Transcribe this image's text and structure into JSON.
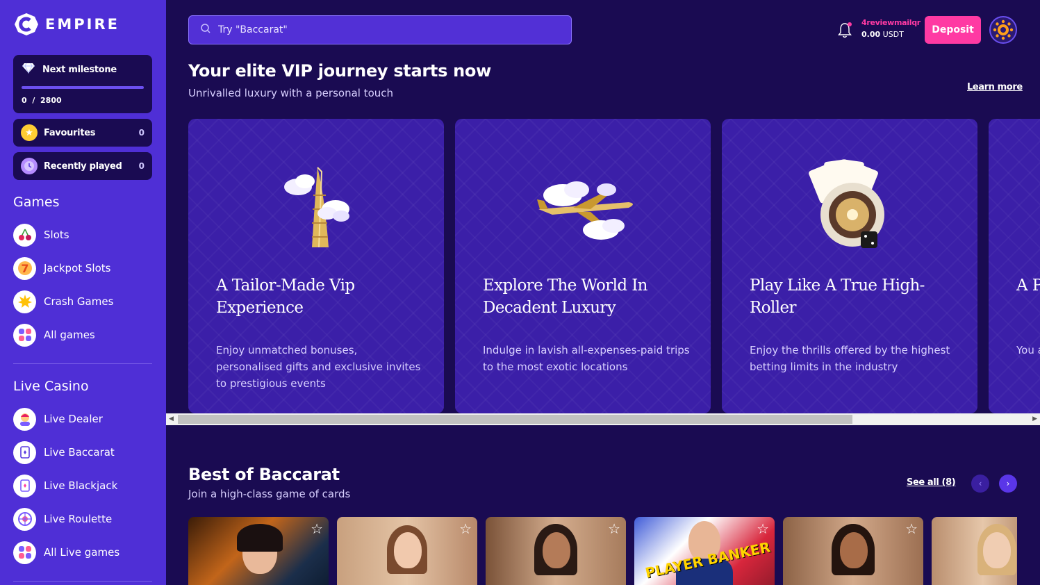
{
  "brand": {
    "name": "EMPIRE"
  },
  "search": {
    "placeholder": "Try \"Baccarat\""
  },
  "user": {
    "username": "4reviewmailqr",
    "balance_amount": "0.00",
    "balance_currency": "USDT"
  },
  "header": {
    "deposit_label": "Deposit"
  },
  "milestone": {
    "title": "Next milestone",
    "current": "0",
    "separator": "/",
    "target": "2800",
    "progress": 0
  },
  "quick": {
    "favourites": {
      "label": "Favourites",
      "count": "0"
    },
    "recent": {
      "label": "Recently played",
      "count": "0"
    }
  },
  "sidebar": {
    "games_title": "Games",
    "games": [
      {
        "label": "Slots",
        "icon": "cherry-icon"
      },
      {
        "label": "Jackpot Slots",
        "icon": "seven-icon"
      },
      {
        "label": "Crash Games",
        "icon": "explosion-icon"
      },
      {
        "label": "All games",
        "icon": "grid-icon"
      }
    ],
    "live_title": "Live Casino",
    "live": [
      {
        "label": "Live Dealer",
        "icon": "dealer-icon"
      },
      {
        "label": "Live Baccarat",
        "icon": "cards-icon"
      },
      {
        "label": "Live Blackjack",
        "icon": "card-icon"
      },
      {
        "label": "Live Roulette",
        "icon": "roulette-icon"
      },
      {
        "label": "All Live games",
        "icon": "grid-icon"
      }
    ]
  },
  "vip": {
    "title": "Your elite VIP journey starts now",
    "subtitle": "Unrivalled luxury with a personal touch",
    "learn_more": "Learn more",
    "cards": [
      {
        "title": "A Tailor-Made Vip Experience",
        "desc": "Enjoy unmatched bonuses, personalised gifts and exclusive invites to prestigious events",
        "art": "tower-icon"
      },
      {
        "title": "Explore The World In Decadent Luxury",
        "desc": "Indulge in lavish all-expenses-paid trips to the most exotic locations",
        "art": "plane-icon"
      },
      {
        "title": "Play Like A True High-Roller",
        "desc": "Enjoy the thrills offered by the highest betting limits in the industry",
        "art": "roulette-cards-icon"
      },
      {
        "title": "A P",
        "desc": "You a pers",
        "art": ""
      }
    ]
  },
  "baccarat": {
    "title": "Best of Baccarat",
    "subtitle": "Join a high-class game of cards",
    "see_all": "See all (8)",
    "games": [
      {
        "theme": "dragon",
        "overlay": ""
      },
      {
        "theme": "dealer-pink",
        "overlay": ""
      },
      {
        "theme": "dealer-smile",
        "overlay": ""
      },
      {
        "theme": "player-banker",
        "overlay": "PLAYER BANKER"
      },
      {
        "theme": "dealer-dark",
        "overlay": ""
      },
      {
        "theme": "dealer-blonde",
        "overlay": ""
      }
    ]
  },
  "colors": {
    "sidebar": "#4f2fd6",
    "background": "#1a0b52",
    "accent": "#ff3aa3",
    "card": "#3b1fa8"
  }
}
